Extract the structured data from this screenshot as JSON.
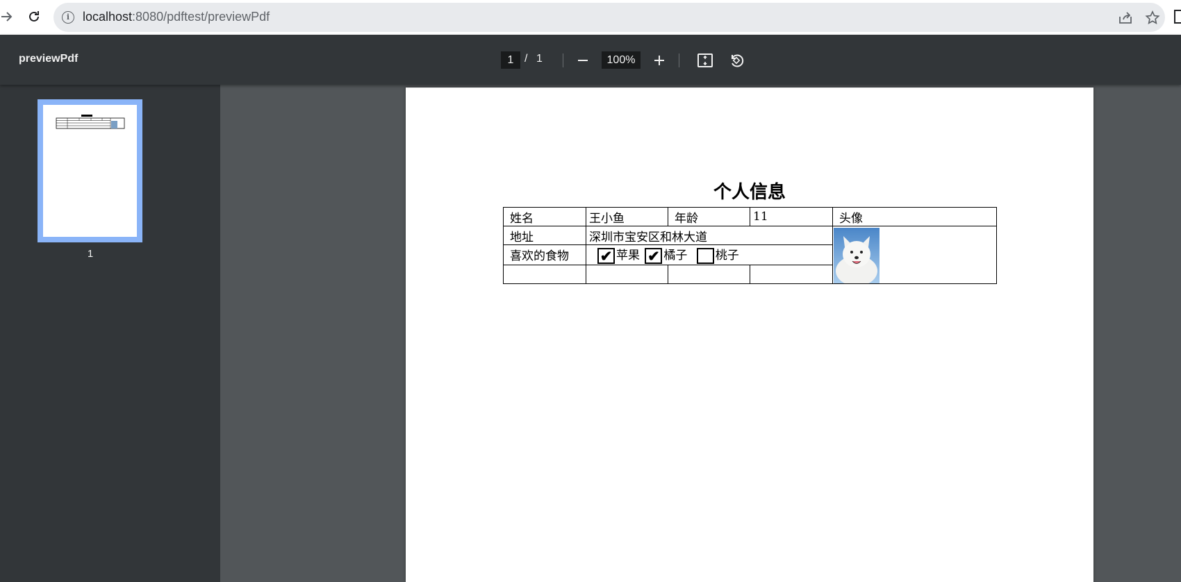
{
  "browser": {
    "url_host": "localhost",
    "url_path": ":8080/pdftest/previewPdf"
  },
  "toolbar": {
    "title": "previewPdf",
    "current_page": "1",
    "page_separator": "/",
    "total_pages": "1",
    "zoom": "100%"
  },
  "sidebar": {
    "thumbnails": [
      {
        "label": "1"
      }
    ]
  },
  "document": {
    "title": "个人信息",
    "table": {
      "name_label": "姓名",
      "name_value": "王小鱼",
      "age_label": "年龄",
      "age_value": "11",
      "avatar_label": "头像",
      "address_label": "地址",
      "address_value": "深圳市宝安区和林大道",
      "food_label": "喜欢的食物",
      "food_options": [
        {
          "label": "苹果",
          "checked": true
        },
        {
          "label": "橘子",
          "checked": true
        },
        {
          "label": "桃子",
          "checked": false
        }
      ],
      "check_mark": "✔"
    }
  },
  "colors": {
    "toolbar_bg": "#323639",
    "viewer_bg": "#525659",
    "thumb_highlight": "#8ab4f8"
  }
}
